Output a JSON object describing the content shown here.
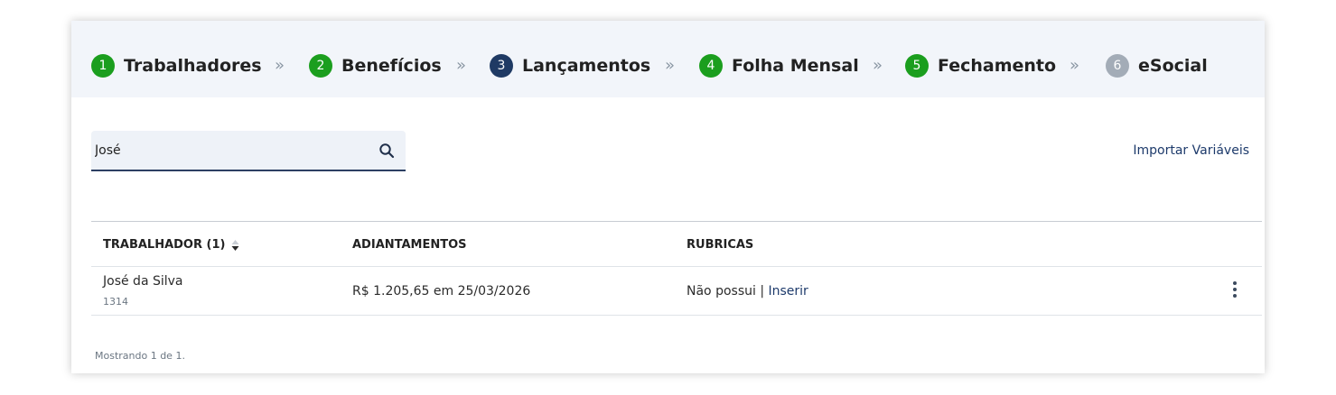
{
  "stepper": {
    "steps": [
      {
        "number": "1",
        "label": "Trabalhadores",
        "status": "done",
        "color": "#1b9e1e"
      },
      {
        "number": "2",
        "label": "Benefícios",
        "status": "done",
        "color": "#1b9e1e"
      },
      {
        "number": "3",
        "label": "Lançamentos",
        "status": "current",
        "color": "#1f3a64"
      },
      {
        "number": "4",
        "label": "Folha Mensal",
        "status": "done",
        "color": "#1b9e1e"
      },
      {
        "number": "5",
        "label": "Fechamento",
        "status": "done",
        "color": "#1b9e1e"
      },
      {
        "number": "6",
        "label": "eSocial",
        "status": "pending",
        "color": "#a3acb7"
      }
    ],
    "separator": "»"
  },
  "search": {
    "value": "José",
    "icon": "search-icon"
  },
  "import_link": "Importar Variáveis",
  "table": {
    "columns": [
      "TRABALHADOR (1)",
      "ADIANTAMENTOS",
      "RUBRICAS"
    ],
    "rows": [
      {
        "name": "José da Silva",
        "code": "1314",
        "advances": "R$ 1.205,65 em 25/03/2026",
        "rubricas_text": "Não possui",
        "rubricas_sep": " | ",
        "rubricas_action": "Inserir"
      }
    ]
  },
  "footer": "Mostrando 1 de 1.",
  "colors": {
    "done": "#1b9e1e",
    "current": "#1f3a64",
    "pending": "#a3acb7",
    "link": "#1d3a6b"
  }
}
